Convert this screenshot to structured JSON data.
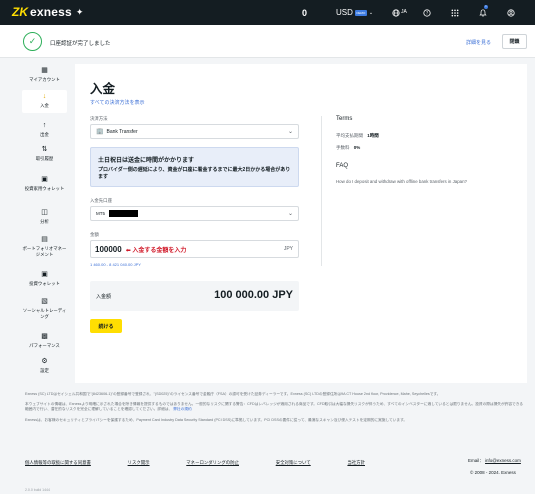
{
  "brand": {
    "mark": "ZK",
    "name": "exness"
  },
  "topbar": {
    "balance": "0",
    "currency": "USD",
    "currency_badge": "DEMO",
    "language": "JA",
    "notification_count": "1"
  },
  "verify": {
    "message": "口座認証が完了しました",
    "details_link": "詳細を見る",
    "close_button": "閉鎖"
  },
  "sidebar": {
    "items": [
      {
        "label": "マイアカウント",
        "icon": "grid-icon"
      },
      {
        "label": "入金",
        "icon": "deposit-icon"
      },
      {
        "label": "出金",
        "icon": "withdraw-icon"
      },
      {
        "label": "取引履歴",
        "icon": "history-icon"
      },
      {
        "label": "投資家用ウォレット",
        "icon": "wallet-icon",
        "badge": "NEW"
      },
      {
        "label": "分析",
        "icon": "analytics-icon"
      },
      {
        "label": "ポートフォリオマネージメント",
        "icon": "portfolio-icon"
      },
      {
        "label": "投資ウォレット",
        "icon": "invest-wallet-icon"
      },
      {
        "label": "ソーシャルトレーディング",
        "icon": "social-icon"
      },
      {
        "label": "パフォーマンス",
        "icon": "performance-icon",
        "badge": "NEW"
      },
      {
        "label": "設定",
        "icon": "gear-icon"
      }
    ]
  },
  "main": {
    "title": "入金",
    "all_methods_link": "すべての決済方法を表示",
    "method_label": "決済方法",
    "method_value": "Bank Transfer",
    "warning_title": "土日祝日は送金に時間がかかります",
    "warning_body": "プロバイダー側の遅延により、資金が口座に着金するまでに最大2日かかる場合があります",
    "account_label": "入金先口座",
    "account_prefix": "MT5",
    "amount_label": "金額",
    "amount_value": "100000",
    "amount_note": "入金する金額を入力",
    "amount_currency": "JPY",
    "range_hint": "1 460.00 - 8 421 040.00 JPY",
    "total_label": "入金額",
    "total_value": "100 000.00 JPY",
    "continue_button": "続ける"
  },
  "terms": {
    "title": "Terms",
    "rows": [
      {
        "label": "平均支払期間",
        "value": "1時間"
      },
      {
        "label": "手数料",
        "value": "0%"
      }
    ],
    "faq_title": "FAQ",
    "faq_link": "How do I deposit and withdraw with offline bank transfers in Japan?"
  },
  "footer": {
    "p1": "Exness (SC) LTDはセイシェル共和国で\"(8423606-1)\"の登録番号で登録され、\"(SD025)\"のライセンス番号で金融庁（FSA）の認可を受けた証券ディーラーです。Exness (SC) LTDの登録住所は9A CT House 2nd floor, Providence, Mahe, Seychellesです。",
    "p2": "本ウェブサイトの情報は、Exnessより明確に示された場合を除き情報を提供するものではありません。一般的なリスクに関する警告：CFDはレバレッジが適用される商品です。CFD取引は大幅な損失リスクが伴うため、すべてのインベスターに適しているとは限りません。投資の際は損失が許容できる範囲内で行い、潜在的なリスクを完全に理解していることを確認してください。詳細は、",
    "p2_link": "弊社の規約",
    "p3": "Exnessは、お客様のセキュリティとプライバシーを保護するため、Payment Card Industry Data Security Standard (PCI DSS)に準拠しています。PCI DSSの要件に従って、最適なスキャン及び侵入テストを定期的に実施しています。",
    "links": [
      "個人情報等の取扱に関する同意書",
      "リスク開示",
      "マネーロンダリングの防止",
      "安全対策について",
      "当社方針"
    ],
    "email_label": "Email：",
    "email": "info@exness.com",
    "copyright": "© 2008 - 2024. Exness",
    "build": "2.0.0 build 1444"
  }
}
